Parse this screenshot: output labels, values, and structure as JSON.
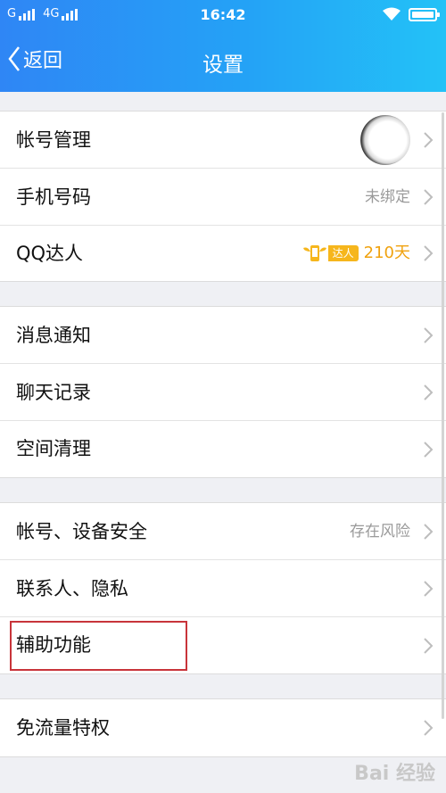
{
  "status_bar": {
    "carrier1": "G",
    "carrier2": "4G",
    "time": "16:42",
    "battery_level": 1.0
  },
  "nav": {
    "back_label": "返回",
    "title": "设置"
  },
  "groups": [
    {
      "rows": [
        {
          "label": "帐号管理",
          "accessory": "avatar"
        },
        {
          "label": "手机号码",
          "value": "未绑定"
        },
        {
          "label": "QQ达人",
          "badge": "达人",
          "value": "210天"
        }
      ]
    },
    {
      "rows": [
        {
          "label": "消息通知"
        },
        {
          "label": "聊天记录"
        },
        {
          "label": "空间清理"
        }
      ]
    },
    {
      "rows": [
        {
          "label": "帐号、设备安全",
          "value": "存在风险"
        },
        {
          "label": "联系人、隐私"
        },
        {
          "label": "辅助功能"
        }
      ]
    },
    {
      "rows": [
        {
          "label": "免流量特权"
        }
      ]
    }
  ],
  "watermark": "Bai 经验",
  "colors": {
    "header_start": "#2f86f5",
    "header_end": "#23c2f7",
    "accent_orange": "#f0a20f",
    "highlight_red": "#c8343a"
  }
}
